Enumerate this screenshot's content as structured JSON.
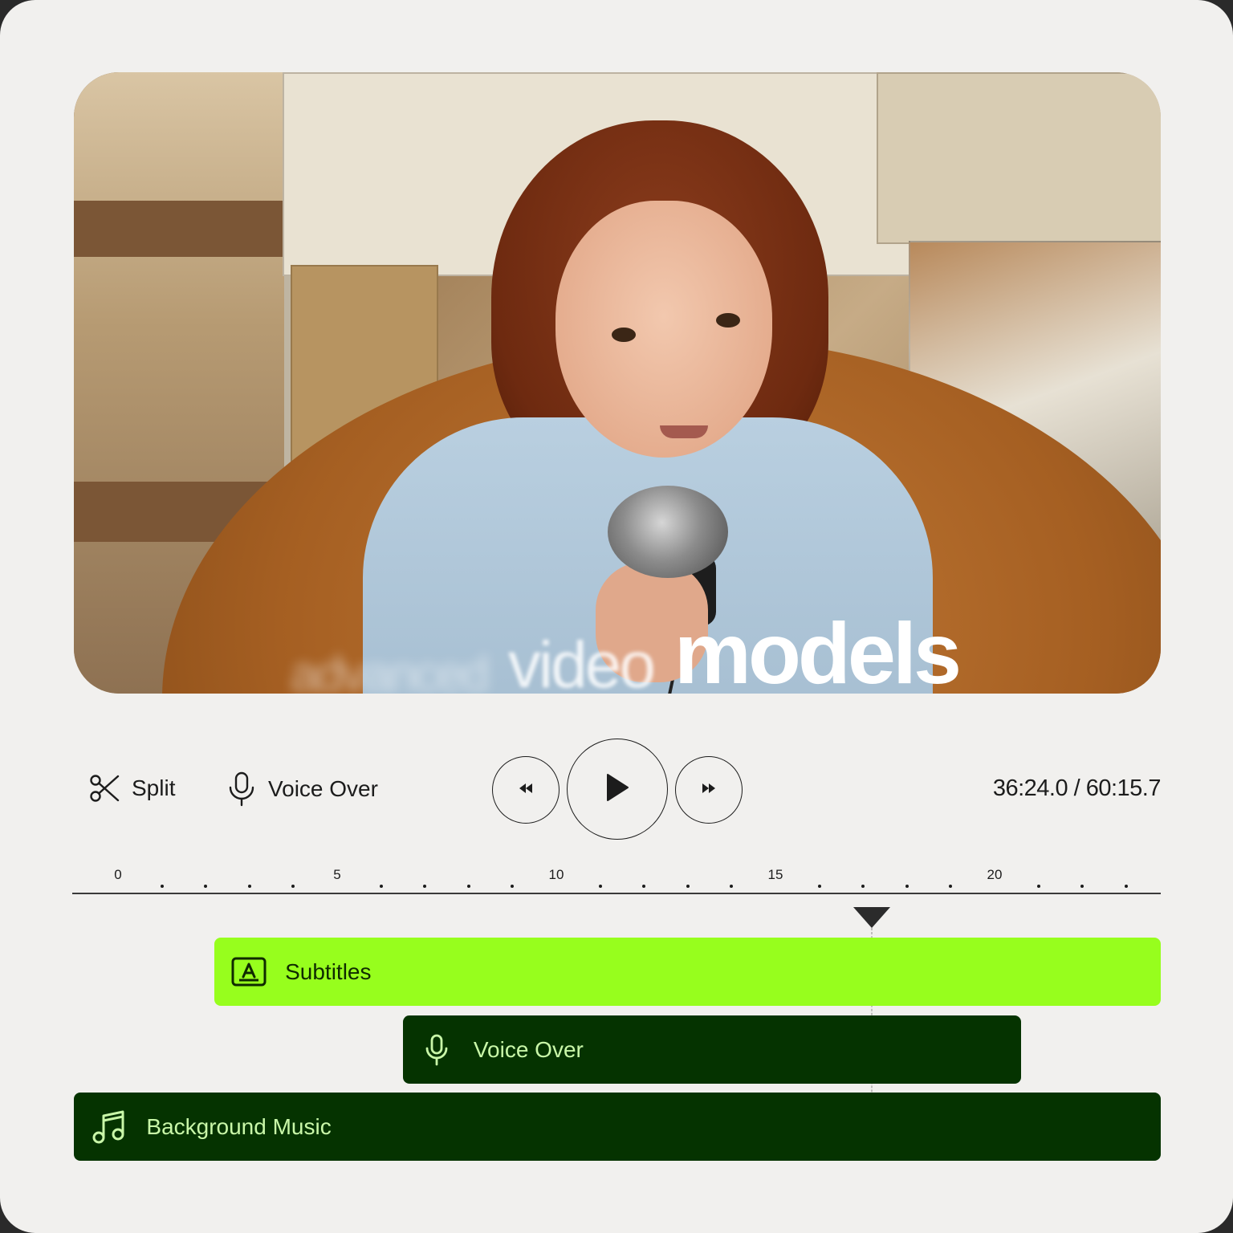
{
  "preview": {
    "caption_words": [
      "advanced",
      "video",
      "models"
    ]
  },
  "toolbar": {
    "split_label": "Split",
    "voice_over_label": "Voice Over",
    "split_icon": "scissors-icon",
    "voice_over_icon": "microphone-icon"
  },
  "transport": {
    "rewind_icon": "rewind-icon",
    "play_icon": "play-icon",
    "fast_forward_icon": "fast-forward-icon"
  },
  "timecode": {
    "current": "36:24.0",
    "total": "60:15.7",
    "display": "36:24.0 / 60:15.7"
  },
  "ruler": {
    "labels": [
      "0",
      "5",
      "10",
      "15",
      "20"
    ],
    "playhead_time": 17.2
  },
  "tracks": [
    {
      "label": "Subtitles",
      "icon": "subtitles-icon",
      "color": "#97fe1d",
      "start": 2.2,
      "end": 25
    },
    {
      "label": "Voice Over",
      "icon": "microphone-icon",
      "color": "#053300",
      "start": 6.5,
      "end": 20.6
    },
    {
      "label": "Background Music",
      "icon": "music-note-icon",
      "color": "#053300",
      "start": -1,
      "end": 25
    }
  ],
  "colors": {
    "accent": "#97fe1d",
    "track_dark": "#053300",
    "track_dark_text": "#c9f7a8",
    "background": "#f1f0ee"
  }
}
